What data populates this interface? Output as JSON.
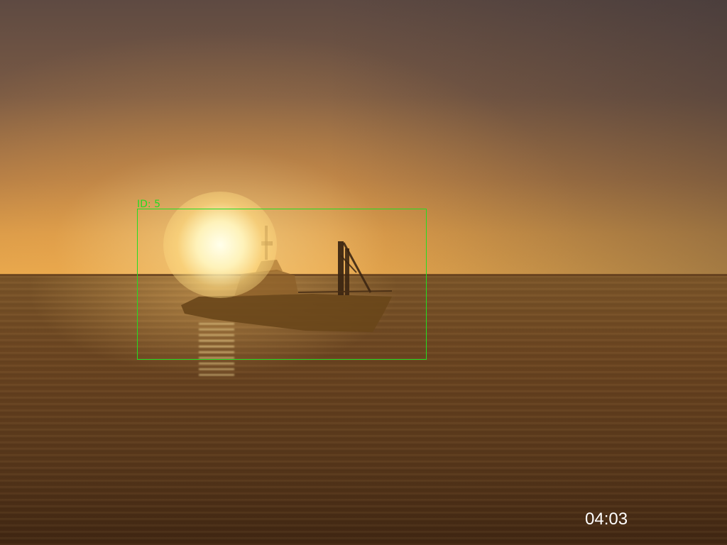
{
  "detection": {
    "label": "ID: 5",
    "box_color": "#22dd22"
  },
  "overlay": {
    "timestamp": "04:03"
  }
}
